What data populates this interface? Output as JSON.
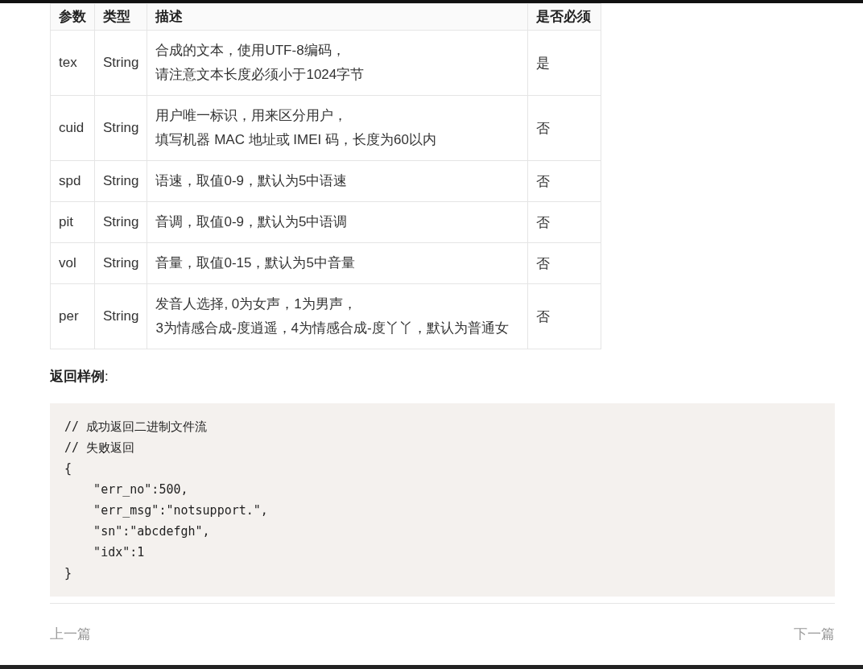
{
  "table": {
    "columns": [
      "参数",
      "类型",
      "描述",
      "是否必须"
    ],
    "rows": [
      {
        "param": "tex",
        "type": "String",
        "description": [
          "合成的文本，使用UTF-8编码，",
          "请注意文本长度必须小于1024字节"
        ],
        "required": "是"
      },
      {
        "param": "cuid",
        "type": "String",
        "description": [
          "用户唯一标识，用来区分用户，",
          "填写机器 MAC 地址或 IMEI 码，长度为60以内"
        ],
        "required": "否"
      },
      {
        "param": "spd",
        "type": "String",
        "description": [
          "语速，取值0-9，默认为5中语速"
        ],
        "required": "否"
      },
      {
        "param": "pit",
        "type": "String",
        "description": [
          "音调，取值0-9，默认为5中语调"
        ],
        "required": "否"
      },
      {
        "param": "vol",
        "type": "String",
        "description": [
          "音量，取值0-15，默认为5中音量"
        ],
        "required": "否"
      },
      {
        "param": "per",
        "type": "String",
        "description": [
          "发音人选择, 0为女声，1为男声，",
          "3为情感合成-度逍遥，4为情感合成-度丫丫，默认为普通女"
        ],
        "required": "否"
      }
    ]
  },
  "heading": "**返回样例**:",
  "code": [
    "// 成功返回二进制文件流",
    "// 失败返回",
    "{",
    "    \"err_no\":500,",
    "    \"err_msg\":\"notsupport.\",",
    "    \"sn\":\"abcdefgh\",",
    "    \"idx\":1",
    "}"
  ],
  "nav": {
    "prev": "上一篇",
    "next": "下一篇"
  }
}
